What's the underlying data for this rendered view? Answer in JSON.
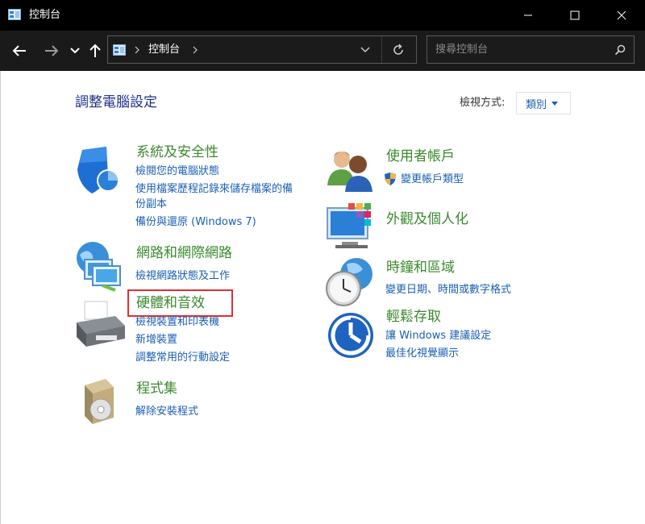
{
  "window": {
    "title": "控制台"
  },
  "address": {
    "path": "控制台"
  },
  "search": {
    "placeholder": "搜尋控制台"
  },
  "page": {
    "title": "調整電腦設定"
  },
  "view_by": {
    "label": "檢視方式:",
    "value": "類別"
  },
  "categories": {
    "security": {
      "title": "系統及安全性",
      "links": [
        "檢閱您的電腦狀態",
        "使用檔案歷程記錄來儲存檔案的備",
        "份副本",
        "備份與還原 (Windows 7)"
      ]
    },
    "network": {
      "title": "網路和網際網路",
      "links": [
        "檢視網路狀態及工作"
      ]
    },
    "hardware": {
      "title": "硬體和音效",
      "links": [
        "檢視裝置和印表機",
        "新增裝置",
        "調整常用的行動設定"
      ]
    },
    "programs": {
      "title": "程式集",
      "links": [
        "解除安裝程式"
      ]
    },
    "users": {
      "title": "使用者帳戶",
      "links": [
        "變更帳戶類型"
      ]
    },
    "appearance": {
      "title": "外觀及個人化",
      "links": []
    },
    "clock": {
      "title": "時鐘和區域",
      "links": [
        "變更日期、時間或數字格式"
      ]
    },
    "ease": {
      "title": "輕鬆存取",
      "links": [
        "讓 Windows 建議設定",
        "最佳化視覺顯示"
      ]
    }
  },
  "colors": {
    "accent_link": "#1a5fb4",
    "category_title": "#3b8a2e",
    "page_title": "#1e3287",
    "highlight_box": "#e03030",
    "titlebar": "#000000"
  },
  "icons": [
    "control-panel-icon",
    "minimize-icon",
    "maximize-icon",
    "close-icon",
    "back-arrow-icon",
    "forward-arrow-icon",
    "recent-locations-icon",
    "up-arrow-icon",
    "chevron-right-icon",
    "chevron-down-icon",
    "refresh-icon",
    "search-icon",
    "shield-icon",
    "network-globe-icon",
    "printer-icon",
    "programs-disc-icon",
    "users-icon",
    "uac-shield-icon",
    "appearance-monitor-icon",
    "clock-globe-icon",
    "ease-of-access-icon"
  ]
}
